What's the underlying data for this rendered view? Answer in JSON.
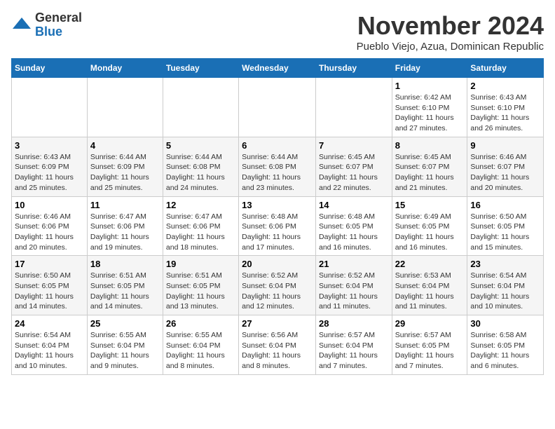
{
  "header": {
    "logo": {
      "general": "General",
      "blue": "Blue"
    },
    "title": "November 2024",
    "location": "Pueblo Viejo, Azua, Dominican Republic"
  },
  "weekdays": [
    "Sunday",
    "Monday",
    "Tuesday",
    "Wednesday",
    "Thursday",
    "Friday",
    "Saturday"
  ],
  "weeks": [
    [
      {
        "day": "",
        "info": ""
      },
      {
        "day": "",
        "info": ""
      },
      {
        "day": "",
        "info": ""
      },
      {
        "day": "",
        "info": ""
      },
      {
        "day": "",
        "info": ""
      },
      {
        "day": "1",
        "info": "Sunrise: 6:42 AM\nSunset: 6:10 PM\nDaylight: 11 hours and 27 minutes."
      },
      {
        "day": "2",
        "info": "Sunrise: 6:43 AM\nSunset: 6:10 PM\nDaylight: 11 hours and 26 minutes."
      }
    ],
    [
      {
        "day": "3",
        "info": "Sunrise: 6:43 AM\nSunset: 6:09 PM\nDaylight: 11 hours and 25 minutes."
      },
      {
        "day": "4",
        "info": "Sunrise: 6:44 AM\nSunset: 6:09 PM\nDaylight: 11 hours and 25 minutes."
      },
      {
        "day": "5",
        "info": "Sunrise: 6:44 AM\nSunset: 6:08 PM\nDaylight: 11 hours and 24 minutes."
      },
      {
        "day": "6",
        "info": "Sunrise: 6:44 AM\nSunset: 6:08 PM\nDaylight: 11 hours and 23 minutes."
      },
      {
        "day": "7",
        "info": "Sunrise: 6:45 AM\nSunset: 6:07 PM\nDaylight: 11 hours and 22 minutes."
      },
      {
        "day": "8",
        "info": "Sunrise: 6:45 AM\nSunset: 6:07 PM\nDaylight: 11 hours and 21 minutes."
      },
      {
        "day": "9",
        "info": "Sunrise: 6:46 AM\nSunset: 6:07 PM\nDaylight: 11 hours and 20 minutes."
      }
    ],
    [
      {
        "day": "10",
        "info": "Sunrise: 6:46 AM\nSunset: 6:06 PM\nDaylight: 11 hours and 20 minutes."
      },
      {
        "day": "11",
        "info": "Sunrise: 6:47 AM\nSunset: 6:06 PM\nDaylight: 11 hours and 19 minutes."
      },
      {
        "day": "12",
        "info": "Sunrise: 6:47 AM\nSunset: 6:06 PM\nDaylight: 11 hours and 18 minutes."
      },
      {
        "day": "13",
        "info": "Sunrise: 6:48 AM\nSunset: 6:06 PM\nDaylight: 11 hours and 17 minutes."
      },
      {
        "day": "14",
        "info": "Sunrise: 6:48 AM\nSunset: 6:05 PM\nDaylight: 11 hours and 16 minutes."
      },
      {
        "day": "15",
        "info": "Sunrise: 6:49 AM\nSunset: 6:05 PM\nDaylight: 11 hours and 16 minutes."
      },
      {
        "day": "16",
        "info": "Sunrise: 6:50 AM\nSunset: 6:05 PM\nDaylight: 11 hours and 15 minutes."
      }
    ],
    [
      {
        "day": "17",
        "info": "Sunrise: 6:50 AM\nSunset: 6:05 PM\nDaylight: 11 hours and 14 minutes."
      },
      {
        "day": "18",
        "info": "Sunrise: 6:51 AM\nSunset: 6:05 PM\nDaylight: 11 hours and 14 minutes."
      },
      {
        "day": "19",
        "info": "Sunrise: 6:51 AM\nSunset: 6:05 PM\nDaylight: 11 hours and 13 minutes."
      },
      {
        "day": "20",
        "info": "Sunrise: 6:52 AM\nSunset: 6:04 PM\nDaylight: 11 hours and 12 minutes."
      },
      {
        "day": "21",
        "info": "Sunrise: 6:52 AM\nSunset: 6:04 PM\nDaylight: 11 hours and 11 minutes."
      },
      {
        "day": "22",
        "info": "Sunrise: 6:53 AM\nSunset: 6:04 PM\nDaylight: 11 hours and 11 minutes."
      },
      {
        "day": "23",
        "info": "Sunrise: 6:54 AM\nSunset: 6:04 PM\nDaylight: 11 hours and 10 minutes."
      }
    ],
    [
      {
        "day": "24",
        "info": "Sunrise: 6:54 AM\nSunset: 6:04 PM\nDaylight: 11 hours and 10 minutes."
      },
      {
        "day": "25",
        "info": "Sunrise: 6:55 AM\nSunset: 6:04 PM\nDaylight: 11 hours and 9 minutes."
      },
      {
        "day": "26",
        "info": "Sunrise: 6:55 AM\nSunset: 6:04 PM\nDaylight: 11 hours and 8 minutes."
      },
      {
        "day": "27",
        "info": "Sunrise: 6:56 AM\nSunset: 6:04 PM\nDaylight: 11 hours and 8 minutes."
      },
      {
        "day": "28",
        "info": "Sunrise: 6:57 AM\nSunset: 6:04 PM\nDaylight: 11 hours and 7 minutes."
      },
      {
        "day": "29",
        "info": "Sunrise: 6:57 AM\nSunset: 6:05 PM\nDaylight: 11 hours and 7 minutes."
      },
      {
        "day": "30",
        "info": "Sunrise: 6:58 AM\nSunset: 6:05 PM\nDaylight: 11 hours and 6 minutes."
      }
    ]
  ]
}
